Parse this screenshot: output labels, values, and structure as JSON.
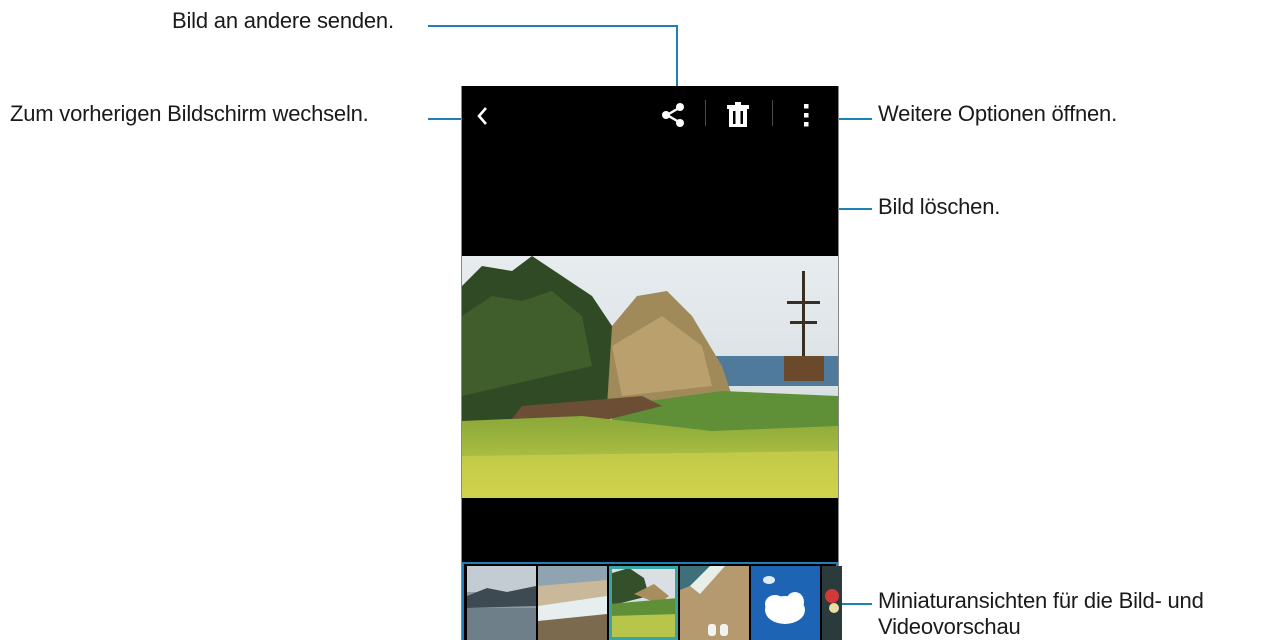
{
  "callouts": {
    "share": "Bild an andere senden.",
    "back": "Zum vorherigen Bildschirm wechseln.",
    "more": "Weitere Optionen öffnen.",
    "delete": "Bild löschen.",
    "thumbnails_line1": "Miniaturansichten für die Bild- und",
    "thumbnails_line2": "Videovorschau"
  },
  "actionbar": {
    "icons": [
      "back-icon",
      "share-icon",
      "trash-icon",
      "more-vert-icon"
    ]
  },
  "filmstrip": {
    "thumbnail_count": 6,
    "selected_index": 2
  },
  "colors": {
    "callout_line": "#1f7fb8",
    "screen_bg": "#000000",
    "selected_thumb": "#3aa3a3"
  }
}
